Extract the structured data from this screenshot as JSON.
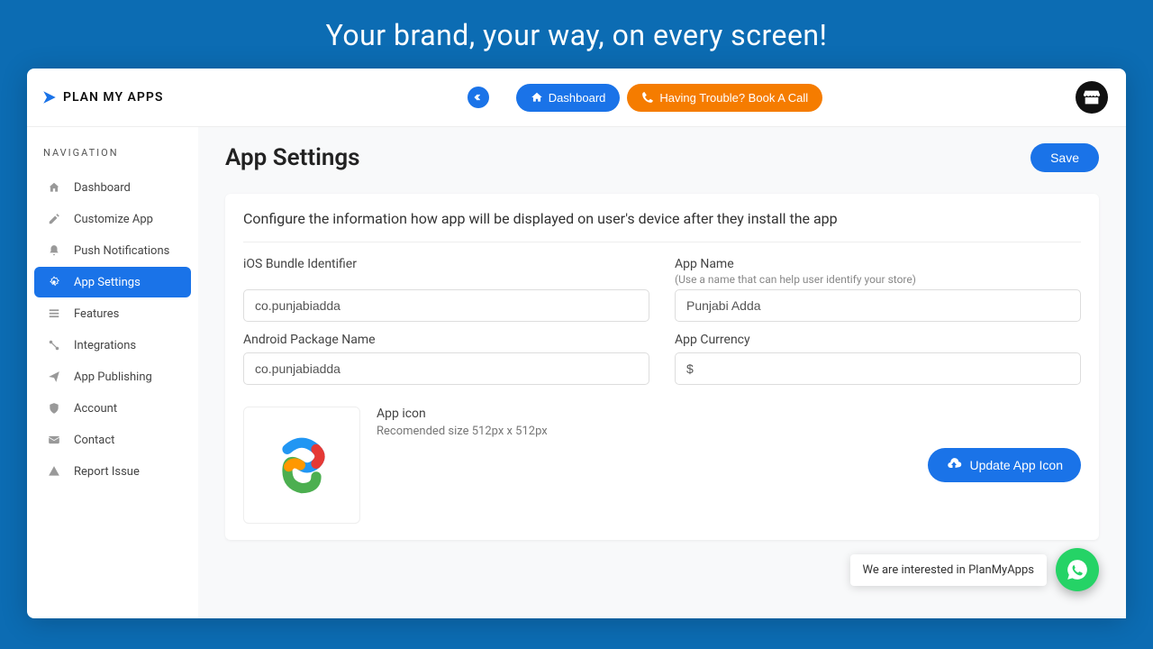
{
  "hero_tagline": "Your brand, your way, on every screen!",
  "brand": "PLAN MY APPS",
  "topbar": {
    "dashboard_label": "Dashboard",
    "trouble_label": "Having Trouble? Book A Call"
  },
  "sidebar": {
    "heading": "NAVIGATION",
    "items": [
      {
        "label": "Dashboard"
      },
      {
        "label": "Customize App"
      },
      {
        "label": "Push Notifications"
      },
      {
        "label": "App Settings"
      },
      {
        "label": "Features"
      },
      {
        "label": "Integrations"
      },
      {
        "label": "App Publishing"
      },
      {
        "label": "Account"
      },
      {
        "label": "Contact"
      },
      {
        "label": "Report Issue"
      }
    ],
    "active_index": 3
  },
  "page": {
    "title": "App Settings",
    "save_label": "Save",
    "description": "Configure the information how app will be displayed on user's device after they install the app",
    "fields": {
      "ios_bundle_label": "iOS Bundle Identifier",
      "ios_bundle_value": "co.punjabiadda",
      "android_pkg_label": "Android Package Name",
      "android_pkg_value": "co.punjabiadda",
      "app_name_label": "App Name",
      "app_name_hint": "(Use a name that can help user identify your store)",
      "app_name_value": "Punjabi Adda",
      "currency_label": "App Currency",
      "currency_value": "$"
    },
    "icon": {
      "title": "App icon",
      "hint": "Recomended size 512px x 512px",
      "update_label": "Update App Icon"
    }
  },
  "whatsapp": {
    "text": "We are interested in PlanMyApps"
  }
}
